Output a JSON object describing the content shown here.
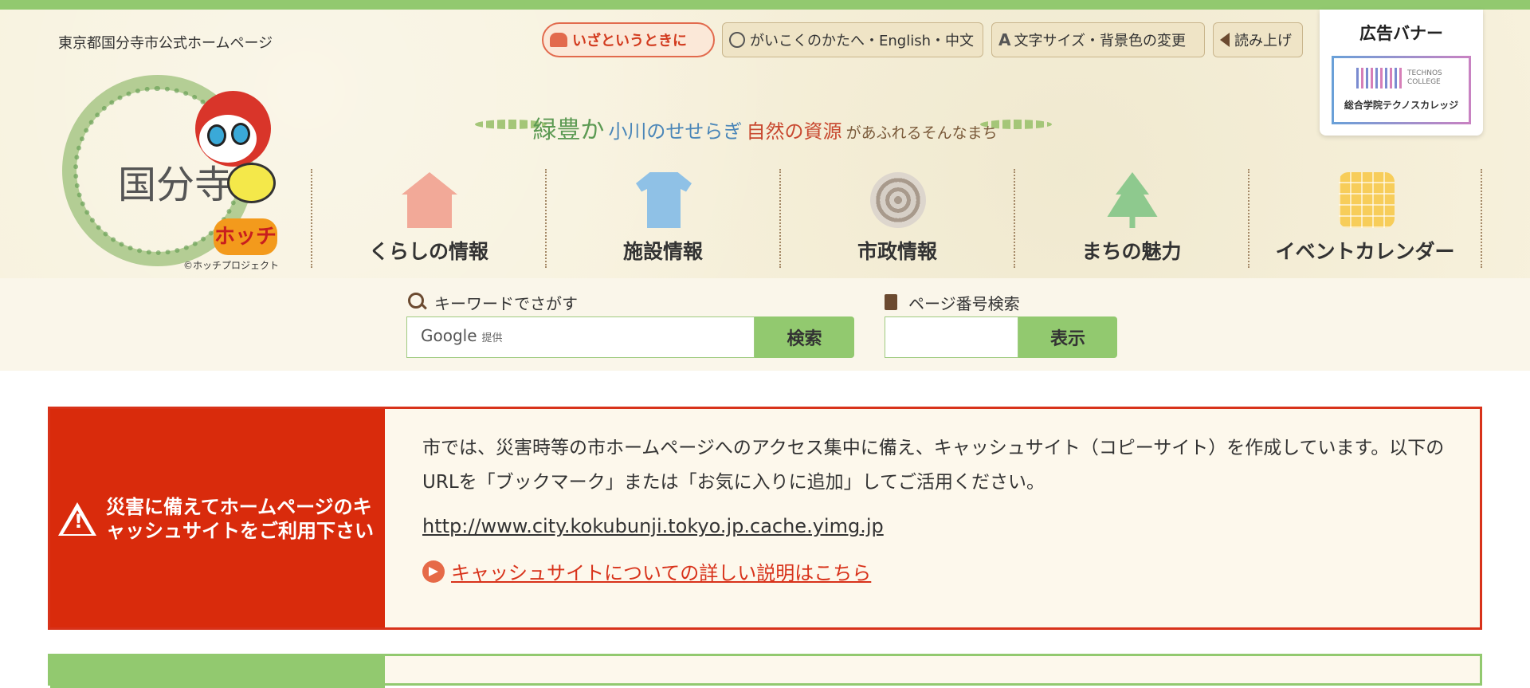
{
  "header": {
    "site_label": "東京都国分寺市公式ホームページ",
    "logo_text": "国分寺",
    "logo_mascot": "ホッチ",
    "logo_copyright": "©ホッチプロジェクト"
  },
  "utility": {
    "emergency": "いざというときに",
    "language": "がいこくのかたへ・English・中文",
    "font_size": "文字サイズ・背景色の変更",
    "read_aloud": "読み上げ"
  },
  "ad": {
    "title": "広告バナー",
    "brand_en_1": "TECHNOS",
    "brand_en_2": "COLLEGE",
    "brand_jp": "総合学院テクノスカレッジ"
  },
  "slogan": {
    "part1": "緑豊か",
    "part2": "小川のせせらぎ",
    "part3": "自然の資源",
    "part4": "があふれるそんなまち"
  },
  "nav": [
    {
      "label": "くらしの情報",
      "icon": "house-icon"
    },
    {
      "label": "施設情報",
      "icon": "shirt-icon"
    },
    {
      "label": "市政情報",
      "icon": "tree-stump-icon"
    },
    {
      "label": "まちの魅力",
      "icon": "tree-icon"
    },
    {
      "label": "イベントカレンダー",
      "icon": "calendar-icon"
    }
  ],
  "search": {
    "keyword_label": "キーワードでさがす",
    "google_text": "Google",
    "google_sub": "提供",
    "keyword_button": "検索",
    "page_label": "ページ番号検索",
    "page_button": "表示"
  },
  "notice": {
    "title": "災害に備えてホームページのキャッシュサイトをご利用下さい",
    "body": "市では、災害時等の市ホームページへのアクセス集中に備え、キャッシュサイト（コピーサイト）を作成しています。以下のURLを「ブックマーク」または「お気に入りに追加」してご活用ください。",
    "url": "http://www.city.kokubunji.tokyo.jp.cache.yimg.jp",
    "link": "キャッシュサイトについての詳しい説明はこちら"
  },
  "colors": {
    "accent_green": "#92c96f",
    "alert_red": "#d92b0c",
    "header_bg": "#f7f1dc"
  }
}
